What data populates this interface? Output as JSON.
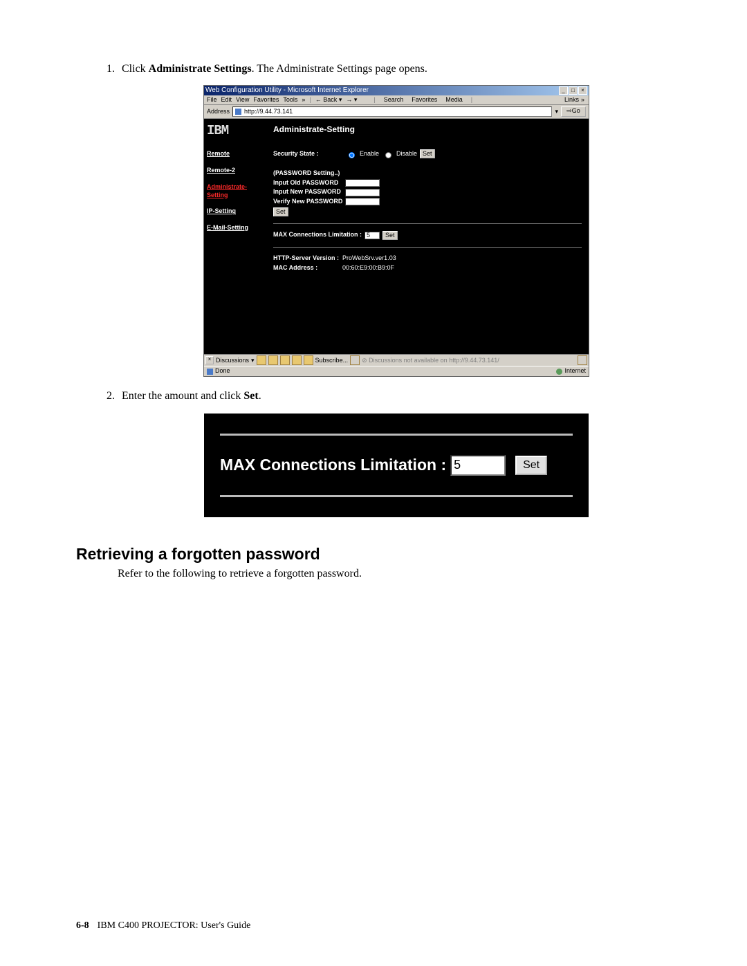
{
  "steps": {
    "s1_prefix": "Click ",
    "s1_bold": "Administrate Settings",
    "s1_suffix": ". The Administrate Settings page opens.",
    "s2_prefix": "Enter the amount and click ",
    "s2_bold": "Set",
    "s2_suffix": "."
  },
  "ie": {
    "title": "Web Configuration Utility - Microsoft Internet Explorer",
    "menu": {
      "file": "File",
      "edit": "Edit",
      "view": "View",
      "favorites": "Favorites",
      "tools": "Tools",
      "help": ""
    },
    "toolbar": {
      "back": "Back",
      "search": "Search",
      "favorites": "Favorites",
      "media": "Media"
    },
    "links_label": "Links",
    "address_label": "Address",
    "address_value": "http://9.44.73.141",
    "go_label": "Go",
    "sidebar": {
      "logo": "IBM",
      "items": [
        "Remote",
        "Remote-2",
        "Administrate-Setting",
        "IP-Setting",
        "E-Mail-Setting"
      ],
      "active_index": 2
    },
    "main": {
      "heading": "Administrate-Setting",
      "security_label": "Security State :",
      "enable": "Enable",
      "disable": "Disable",
      "set": "Set",
      "pw_section": "(PASSWORD Setting..)",
      "pw_old": "Input Old PASSWORD",
      "pw_new": "Input New PASSWORD",
      "pw_verify": "Verify New PASSWORD",
      "max_conn_label": "MAX Connections Limitation :",
      "max_conn_value": "5",
      "http_version_label": "HTTP-Server Version :",
      "http_version_value": "ProWebSrv.ver1.03",
      "mac_label": "MAC Address :",
      "mac_value": "00:60:E9:00:B9:0F"
    },
    "discussions": {
      "label": "Discussions",
      "subscribe": "Subscribe...",
      "not_available": "Discussions not available on http://9.44.73.141/"
    },
    "status": {
      "done": "Done",
      "zone": "Internet"
    }
  },
  "zoom": {
    "label": "MAX Connections Limitation :",
    "value": "5",
    "set": "Set"
  },
  "section": {
    "heading": "Retrieving a forgotten password",
    "body": "Refer to the following to retrieve a forgotten password."
  },
  "footer": {
    "pagenum": "6-8",
    "title": "IBM C400 PROJECTOR: User's Guide"
  }
}
